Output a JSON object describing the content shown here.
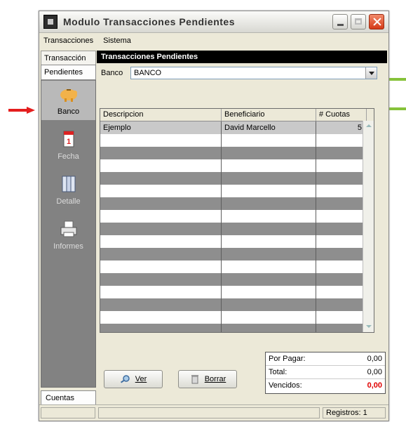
{
  "window": {
    "title": "Modulo  Transacciones Pendientes"
  },
  "menu": [
    "Transacciones",
    "Sistema"
  ],
  "left": {
    "top_tab": "Transacción",
    "pendientes_tab": "Pendientes",
    "nav": [
      {
        "label": "Banco",
        "icon": "piggy-bank-icon",
        "active": true
      },
      {
        "label": "Fecha",
        "icon": "calendar-icon",
        "active": false
      },
      {
        "label": "Detalle",
        "icon": "binders-icon",
        "active": false
      },
      {
        "label": "Informes",
        "icon": "printer-icon",
        "active": false
      }
    ],
    "cuentas_tab": "Cuentas"
  },
  "content": {
    "heading": "Transacciones Pendientes",
    "bank_label": "Banco",
    "bank_value": "BANCO"
  },
  "grid": {
    "columns": [
      "Descripcion",
      "Beneficiario",
      "# Cuotas"
    ],
    "rows": [
      {
        "descripcion": "Ejemplo",
        "beneficiario": "David Marcello",
        "cuotas": "5"
      }
    ]
  },
  "buttons": {
    "ver": "Ver",
    "borrar": "Borrar"
  },
  "summary": {
    "por_pagar_label": "Por Pagar:",
    "por_pagar_value": "0,00",
    "total_label": "Total:",
    "total_value": "0,00",
    "vencidos_label": "Vencidos:",
    "vencidos_value": "0,00"
  },
  "status": {
    "registros": "Registros: 1"
  },
  "colors": {
    "annotation_red": "#e41e1e",
    "annotation_green": "#86c23a",
    "annotation_blue": "#1d3f8f",
    "vencidos_red": "#e00000"
  }
}
